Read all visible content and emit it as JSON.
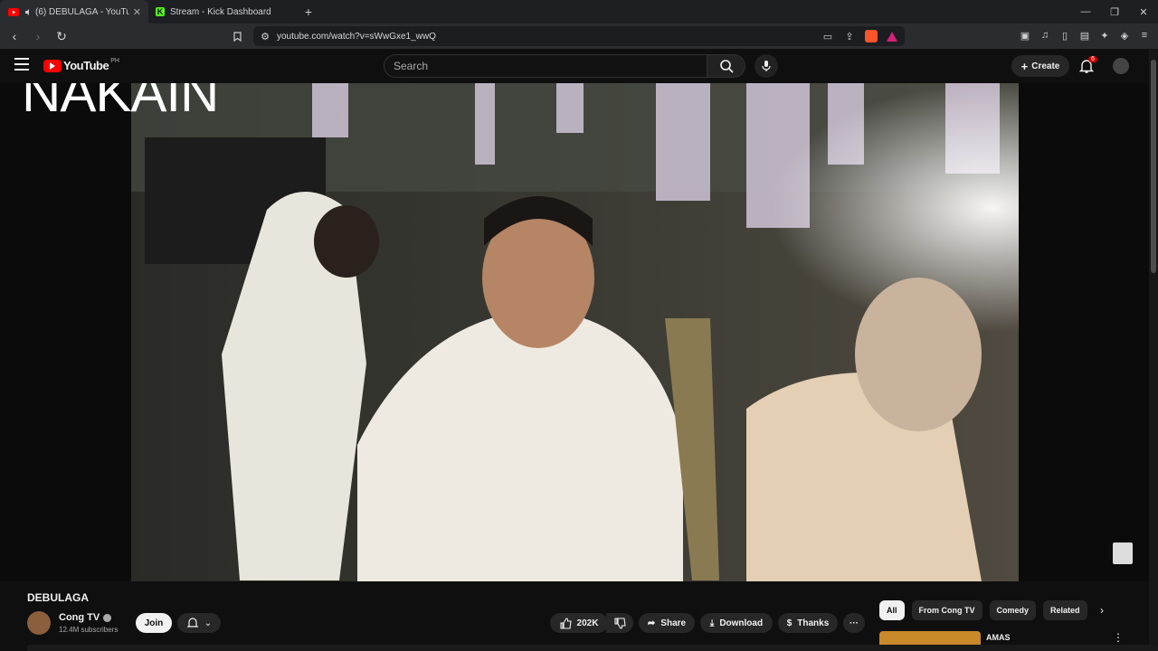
{
  "browser": {
    "tabs": [
      {
        "title": "(6) DEBULAGA - YouTube",
        "active": true
      },
      {
        "title": "Stream - Kick Dashboard",
        "active": false
      }
    ],
    "url": "youtube.com/watch?v=sWwGxe1_wwQ",
    "new_tab": "+",
    "close": "✕",
    "minimize": "—",
    "restore": "❐",
    "win_close": "✕"
  },
  "youtube": {
    "logo_text": "YouTube",
    "country": "PH",
    "search_placeholder": "Search",
    "create_label": "Create",
    "notification_count": "6"
  },
  "video": {
    "overlay_text": "NAKAIN",
    "title": "DEBULAGA",
    "channel": "Cong TV",
    "subscribers": "12.4M subscribers",
    "join_label": "Join",
    "likes": "202K",
    "share_label": "Share",
    "download_label": "Download",
    "thanks_label": "Thanks",
    "more_label": "···"
  },
  "chips": [
    "All",
    "From Cong TV",
    "Comedy",
    "Related"
  ],
  "recommendation": {
    "title": "AMAS"
  }
}
